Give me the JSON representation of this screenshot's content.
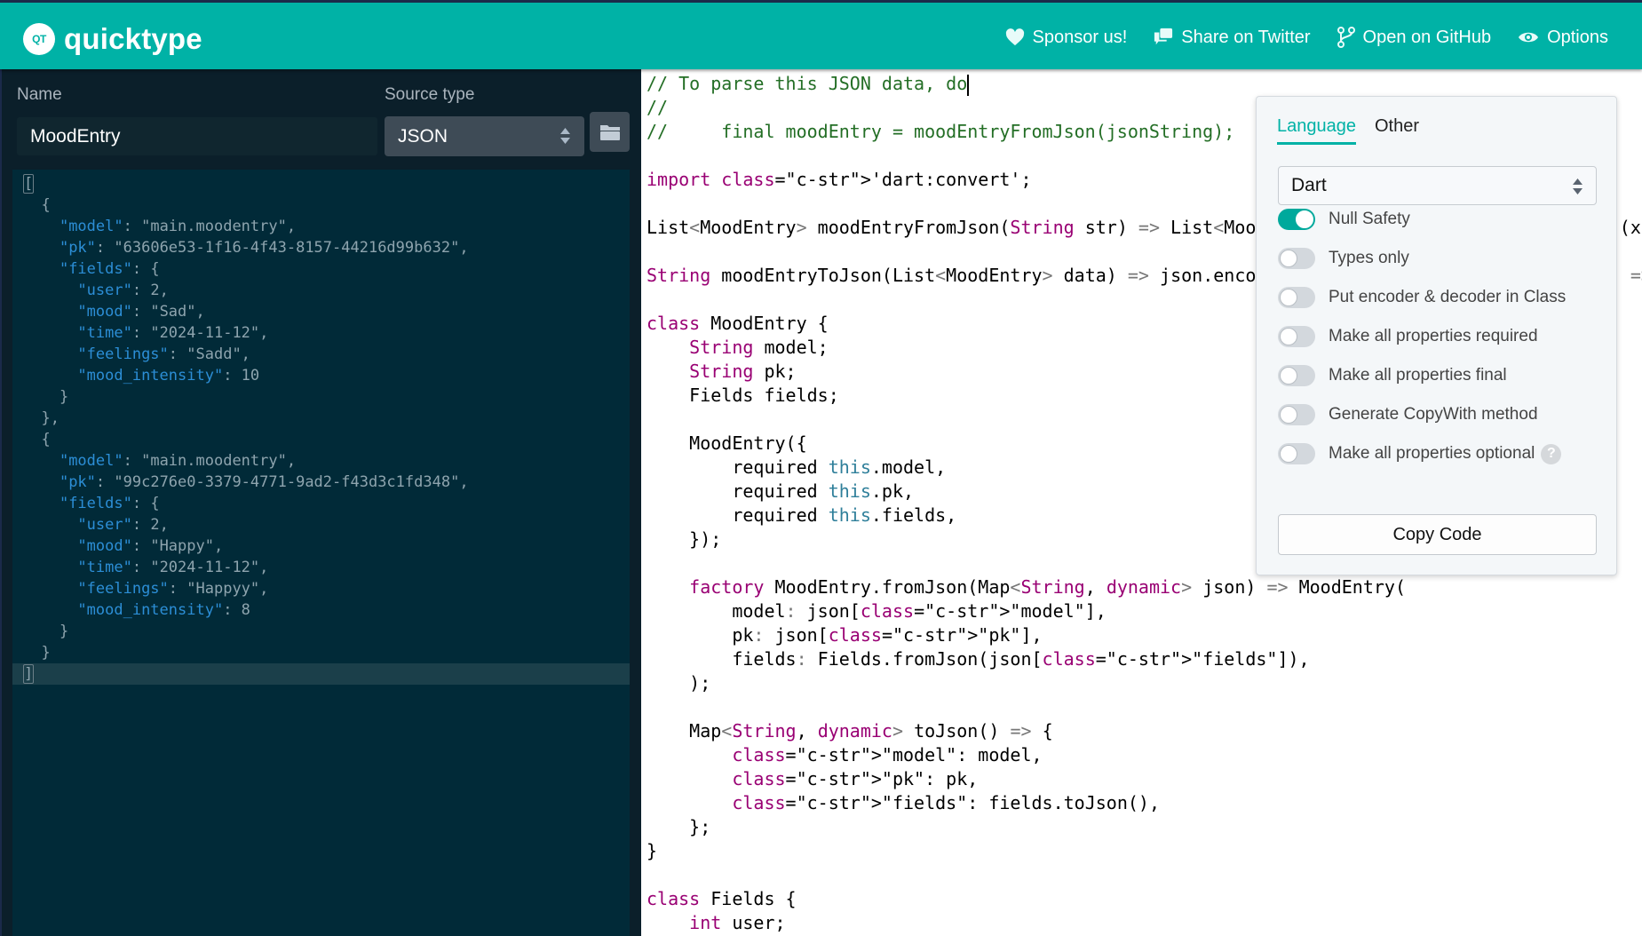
{
  "header": {
    "logo_badge": "QT",
    "logo_text": "quicktype",
    "nav": [
      {
        "icon": "heart-icon",
        "label": "Sponsor us!"
      },
      {
        "icon": "speech-bubbles-icon",
        "label": "Share on Twitter"
      },
      {
        "icon": "git-branch-icon",
        "label": "Open on GitHub"
      },
      {
        "icon": "eye-icon",
        "label": "Options"
      }
    ]
  },
  "left_panel": {
    "name_label": "Name",
    "name_value": "MoodEntry",
    "source_type_label": "Source type",
    "source_type_value": "JSON",
    "json_lines": [
      "[",
      "  {",
      "    \"model\": \"main.moodentry\",",
      "    \"pk\": \"63606e53-1f16-4f43-8157-44216d99b632\",",
      "    \"fields\": {",
      "      \"user\": 2,",
      "      \"mood\": \"Sad\",",
      "      \"time\": \"2024-11-12\",",
      "      \"feelings\": \"Sadd\",",
      "      \"mood_intensity\": 10",
      "    }",
      "  },",
      "  {",
      "    \"model\": \"main.moodentry\",",
      "    \"pk\": \"99c276e0-3379-4771-9ad2-f43d3c1fd348\",",
      "    \"fields\": {",
      "      \"user\": 2,",
      "      \"mood\": \"Happy\",",
      "      \"time\": \"2024-11-12\",",
      "      \"feelings\": \"Happyy\",",
      "      \"mood_intensity\": 8",
      "    }",
      "  }",
      "]"
    ]
  },
  "code_panel": {
    "language": "Dart",
    "lines": [
      "// To parse this JSON data, do",
      "//",
      "//     final moodEntry = moodEntryFromJson(jsonString);",
      "",
      "import 'dart:convert';",
      "",
      "List<MoodEntry> moodEntryFromJson(String str) => List<MoodEntry>.from(json.decode(str).map((x) => MoodEntry.fromJson(x)));",
      "",
      "String moodEntryToJson(List<MoodEntry> data) => json.encode(List<dynamic>.from(data.map((x) => x.toJson())));",
      "",
      "class MoodEntry {",
      "    String model;",
      "    String pk;",
      "    Fields fields;",
      "",
      "    MoodEntry({",
      "        required this.model,",
      "        required this.pk,",
      "        required this.fields,",
      "    });",
      "",
      "    factory MoodEntry.fromJson(Map<String, dynamic> json) => MoodEntry(",
      "        model: json[\"model\"],",
      "        pk: json[\"pk\"],",
      "        fields: Fields.fromJson(json[\"fields\"]),",
      "    );",
      "",
      "    Map<String, dynamic> toJson() => {",
      "        \"model\": model,",
      "        \"pk\": pk,",
      "        \"fields\": fields.toJson(),",
      "    };",
      "}",
      "",
      "class Fields {",
      "    int user;"
    ]
  },
  "options": {
    "tabs": [
      {
        "label": "Language",
        "active": true
      },
      {
        "label": "Other",
        "active": false
      }
    ],
    "language_value": "Dart",
    "toggles": [
      {
        "label": "Null Safety",
        "on": true
      },
      {
        "label": "Types only",
        "on": false
      },
      {
        "label": "Put encoder & decoder in Class",
        "on": false
      },
      {
        "label": "Make all properties required",
        "on": false
      },
      {
        "label": "Make all properties final",
        "on": false
      },
      {
        "label": "Generate CopyWith method",
        "on": false
      },
      {
        "label": "Make all properties optional",
        "on": false,
        "help": true
      }
    ],
    "help_glyph": "?",
    "copy_button_label": "Copy Code"
  },
  "colors": {
    "brand_teal": "#00b2a6",
    "left_bg": "#0b1f2a",
    "editor_bg": "#012a38"
  }
}
